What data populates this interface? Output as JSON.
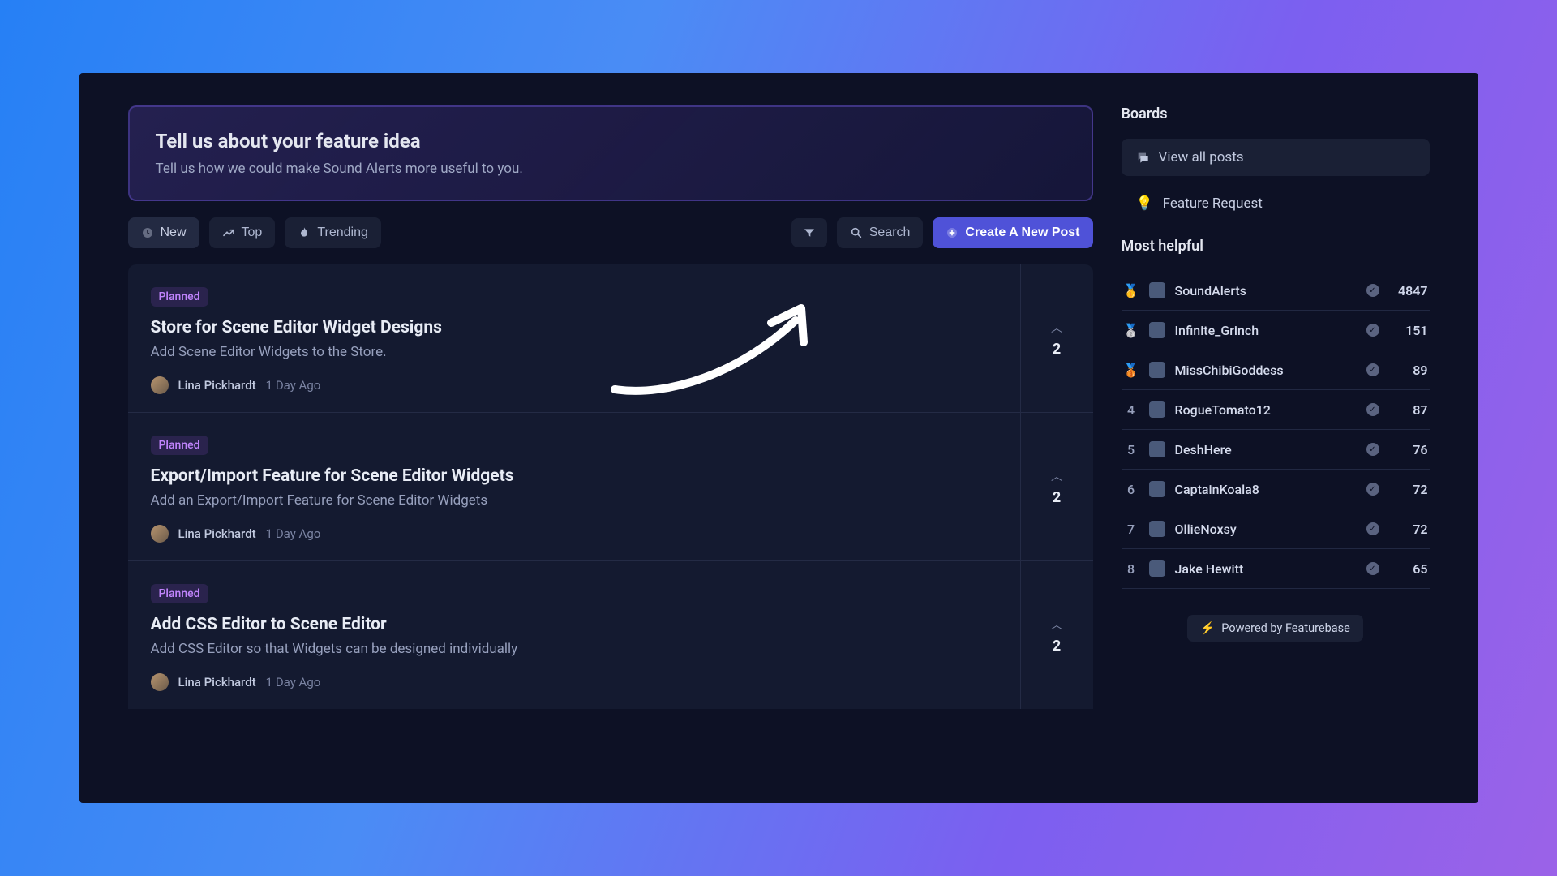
{
  "hero": {
    "title": "Tell us about your feature idea",
    "subtitle": "Tell us how we could make Sound Alerts more useful to you."
  },
  "toolbar": {
    "new": "New",
    "top": "Top",
    "trending": "Trending",
    "search": "Search",
    "create": "Create A New Post"
  },
  "posts": [
    {
      "status": "Planned",
      "title": "Store for Scene Editor Widget Designs",
      "description": "Add Scene Editor Widgets to the Store.",
      "author": "Lina Pickhardt",
      "time": "1 Day Ago",
      "votes": "2"
    },
    {
      "status": "Planned",
      "title": "Export/Import Feature for Scene Editor Widgets",
      "description": "Add an Export/Import Feature for Scene Editor Widgets",
      "author": "Lina Pickhardt",
      "time": "1 Day Ago",
      "votes": "2"
    },
    {
      "status": "Planned",
      "title": "Add CSS Editor to Scene Editor",
      "description": "Add CSS Editor so that Widgets can be designed individually",
      "author": "Lina Pickhardt",
      "time": "1 Day Ago",
      "votes": "2"
    }
  ],
  "sidebar": {
    "boards_title": "Boards",
    "view_all": "View all posts",
    "feature_request": "Feature Request",
    "helpful_title": "Most helpful",
    "helpful": [
      {
        "rank": "🥇",
        "name": "SoundAlerts",
        "score": "4847"
      },
      {
        "rank": "🥈",
        "name": "Infinite_Grinch",
        "score": "151"
      },
      {
        "rank": "🥉",
        "name": "MissChibiGoddess",
        "score": "89"
      },
      {
        "rank": "4",
        "name": "RogueTomato12",
        "score": "87"
      },
      {
        "rank": "5",
        "name": "DeshHere",
        "score": "76"
      },
      {
        "rank": "6",
        "name": "CaptainKoala8",
        "score": "72"
      },
      {
        "rank": "7",
        "name": "OllieNoxsy",
        "score": "72"
      },
      {
        "rank": "8",
        "name": "Jake Hewitt",
        "score": "65"
      }
    ],
    "powered": "Powered by Featurebase"
  }
}
